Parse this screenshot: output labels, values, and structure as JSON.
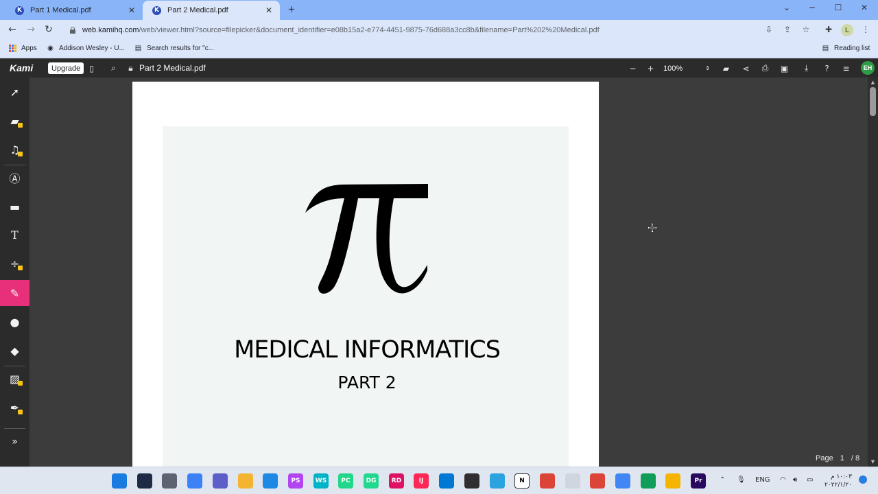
{
  "browser": {
    "tabs": [
      {
        "label": "Part 1 Medical.pdf",
        "favicon": "K"
      },
      {
        "label": "Part 2 Medical.pdf",
        "favicon": "K"
      }
    ],
    "new_tab": "+",
    "address": {
      "host": "web.kamihq.com",
      "rest": "/web/viewer.html?source=filepicker&document_identifier=e08b15a2-e774-4451-9875-76d688a3cc8b&filename=Part%202%20Medical.pdf"
    },
    "profile_initial": "L"
  },
  "bookmarks": {
    "items": [
      {
        "label": "Apps"
      },
      {
        "label": "Addison Wesley - U..."
      },
      {
        "label": "Search results for \"c..."
      }
    ],
    "reading_list": "Reading list"
  },
  "kami": {
    "logo": "Kami",
    "upgrade_label": "Upgrade",
    "document_name": "Part 2 Medical.pdf",
    "zoom": "100%",
    "user_initials": "EH",
    "page_label": "Page",
    "current_page": "1",
    "total_pages": "/ 8"
  },
  "document": {
    "symbol": "π",
    "title": "MEDICAL INFORMATICS",
    "subtitle": "PART 2"
  },
  "taskbar": {
    "apps": [
      {
        "name": "windows-start",
        "color": "#1a7be0",
        "glyph": ""
      },
      {
        "name": "search",
        "color": "#1f2a44",
        "glyph": ""
      },
      {
        "name": "task-view",
        "color": "#5b6470",
        "glyph": ""
      },
      {
        "name": "widgets",
        "color": "#3b82f6",
        "glyph": ""
      },
      {
        "name": "teams",
        "color": "#5b5fc7",
        "glyph": ""
      },
      {
        "name": "file-explorer",
        "color": "#f3b431",
        "glyph": ""
      },
      {
        "name": "mail",
        "color": "#1e88e5",
        "glyph": ""
      },
      {
        "name": "phpstorm",
        "color": "#b345f1",
        "glyph": "PS"
      },
      {
        "name": "webstorm",
        "color": "#00b3c7",
        "glyph": "WS"
      },
      {
        "name": "pycharm",
        "color": "#21d789",
        "glyph": "PC"
      },
      {
        "name": "datagrip",
        "color": "#22d88f",
        "glyph": "DG"
      },
      {
        "name": "rider",
        "color": "#dd1265",
        "glyph": "RD"
      },
      {
        "name": "intellij",
        "color": "#fe2857",
        "glyph": "IJ"
      },
      {
        "name": "azure-data-studio",
        "color": "#0078d4",
        "glyph": ""
      },
      {
        "name": "obs",
        "color": "#302e31",
        "glyph": ""
      },
      {
        "name": "telegram",
        "color": "#2aa3df",
        "glyph": ""
      },
      {
        "name": "notion",
        "color": "#ffffff",
        "glyph": "N"
      },
      {
        "name": "chrome-1",
        "color": "#db4437",
        "glyph": ""
      },
      {
        "name": "chatgpt",
        "color": "#cfd6df",
        "glyph": ""
      },
      {
        "name": "chrome-2",
        "color": "#db4437",
        "glyph": ""
      },
      {
        "name": "chrome-3",
        "color": "#4285f4",
        "glyph": ""
      },
      {
        "name": "chrome-4",
        "color": "#0f9d58",
        "glyph": ""
      },
      {
        "name": "chrome-5",
        "color": "#f4b400",
        "glyph": ""
      },
      {
        "name": "premiere",
        "color": "#2a0a5e",
        "glyph": "Pr"
      }
    ],
    "language": "ENG",
    "time": "١٠:٠٣ م",
    "date": "٢٠٢٢/١/٢٠"
  }
}
